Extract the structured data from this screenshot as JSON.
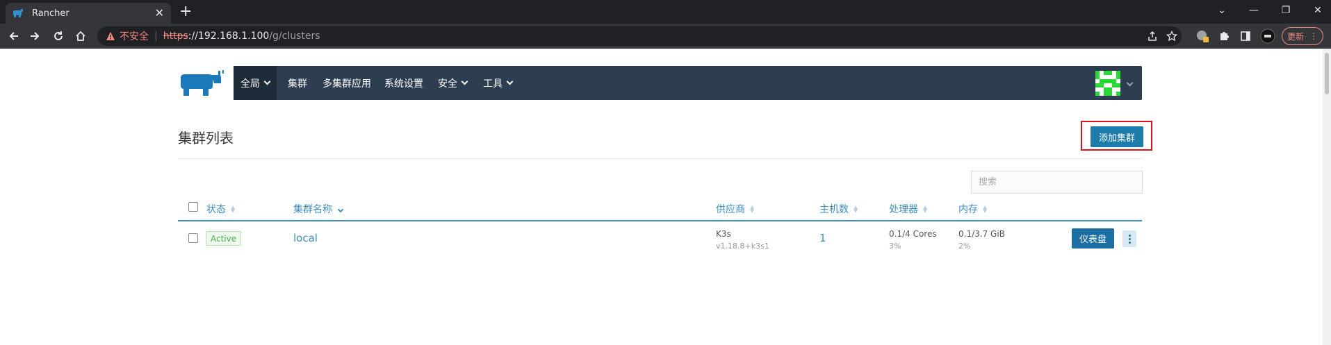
{
  "browser": {
    "tab_title": "Rancher",
    "tab_close": "✕",
    "new_tab": "+",
    "window_controls": [
      "⌄",
      "—",
      "❐",
      "✕"
    ],
    "insecure_label": "不安全",
    "url_scheme": "https",
    "url_host": "://192.168.1.100",
    "url_path": "/g/clusters",
    "update_label": "更新",
    "update_menu": "⋮"
  },
  "app": {
    "nav": {
      "global": "全局",
      "clusters": "集群",
      "multi_cluster_apps": "多集群应用",
      "settings": "系统设置",
      "security": "安全",
      "tools": "工具"
    },
    "page_title": "集群列表",
    "add_cluster_label": "添加集群",
    "search_placeholder": "搜索",
    "table": {
      "headers": {
        "state": "状态",
        "name": "集群名称",
        "provider": "供应商",
        "nodes": "主机数",
        "cpu": "处理器",
        "memory": "内存"
      },
      "rows": [
        {
          "state": "Active",
          "name": "local",
          "provider": "K3s",
          "provider_version": "v1.18.8+k3s1",
          "nodes": "1",
          "cpu": "0.1/4 Cores",
          "cpu_pct": "3%",
          "memory": "0.1/3.7 GiB",
          "memory_pct": "2%",
          "dashboard_label": "仪表盘"
        }
      ]
    }
  },
  "colors": {
    "nav_bg": "#2c3e50",
    "primary": "#1c7dad",
    "link": "#3a8fc7",
    "active_badge": "#4caf50",
    "highlight": "#e0101a"
  }
}
